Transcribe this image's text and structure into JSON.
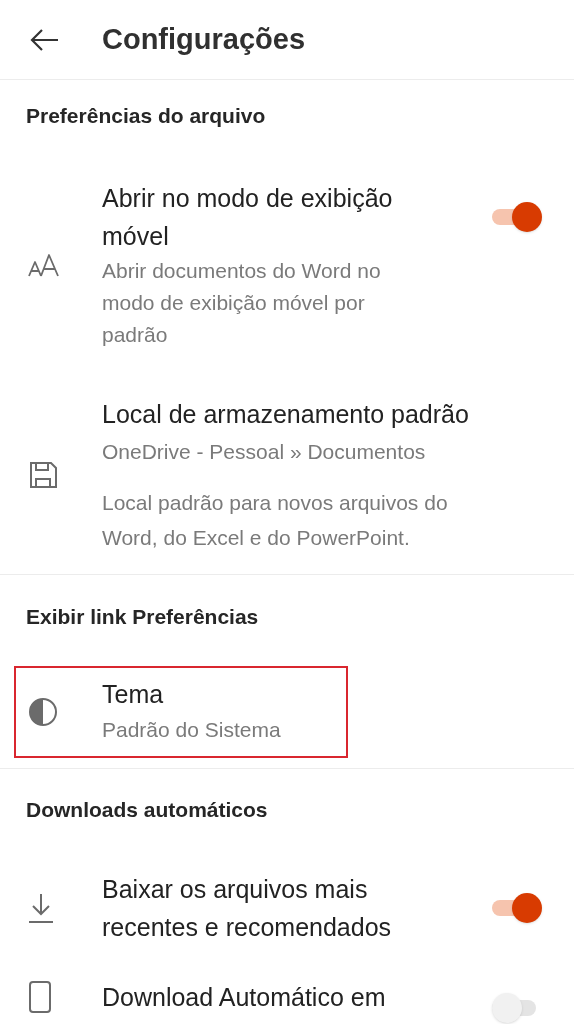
{
  "header": {
    "title": "Configurações"
  },
  "sections": [
    {
      "title": "Preferências do arquivo",
      "items": [
        {
          "kind": "toggle",
          "title": "Abrir no modo de exibição móvel",
          "description": "Abrir documentos do Word no modo de exibição móvel por padrão",
          "on": true,
          "highlighted": false
        },
        {
          "kind": "nav",
          "title": "Local de armazenamento padrão",
          "subtitle": "OneDrive - Pessoal » Documentos",
          "description": "Local padrão para novos arquivos do Word, do Excel e do PowerPoint.",
          "highlighted": false
        }
      ]
    },
    {
      "title": "Exibir link Preferências",
      "items": [
        {
          "kind": "nav",
          "title": "Tema",
          "subtitle": "Padrão do Sistema",
          "highlighted": true
        }
      ]
    },
    {
      "title": "Downloads automáticos",
      "items": [
        {
          "kind": "toggle",
          "title": "Baixar os arquivos mais recentes e recomendados",
          "on": true,
          "highlighted": false
        },
        {
          "kind": "toggle",
          "title": "Download Automático em",
          "on": false,
          "highlighted": false
        }
      ]
    }
  ]
}
